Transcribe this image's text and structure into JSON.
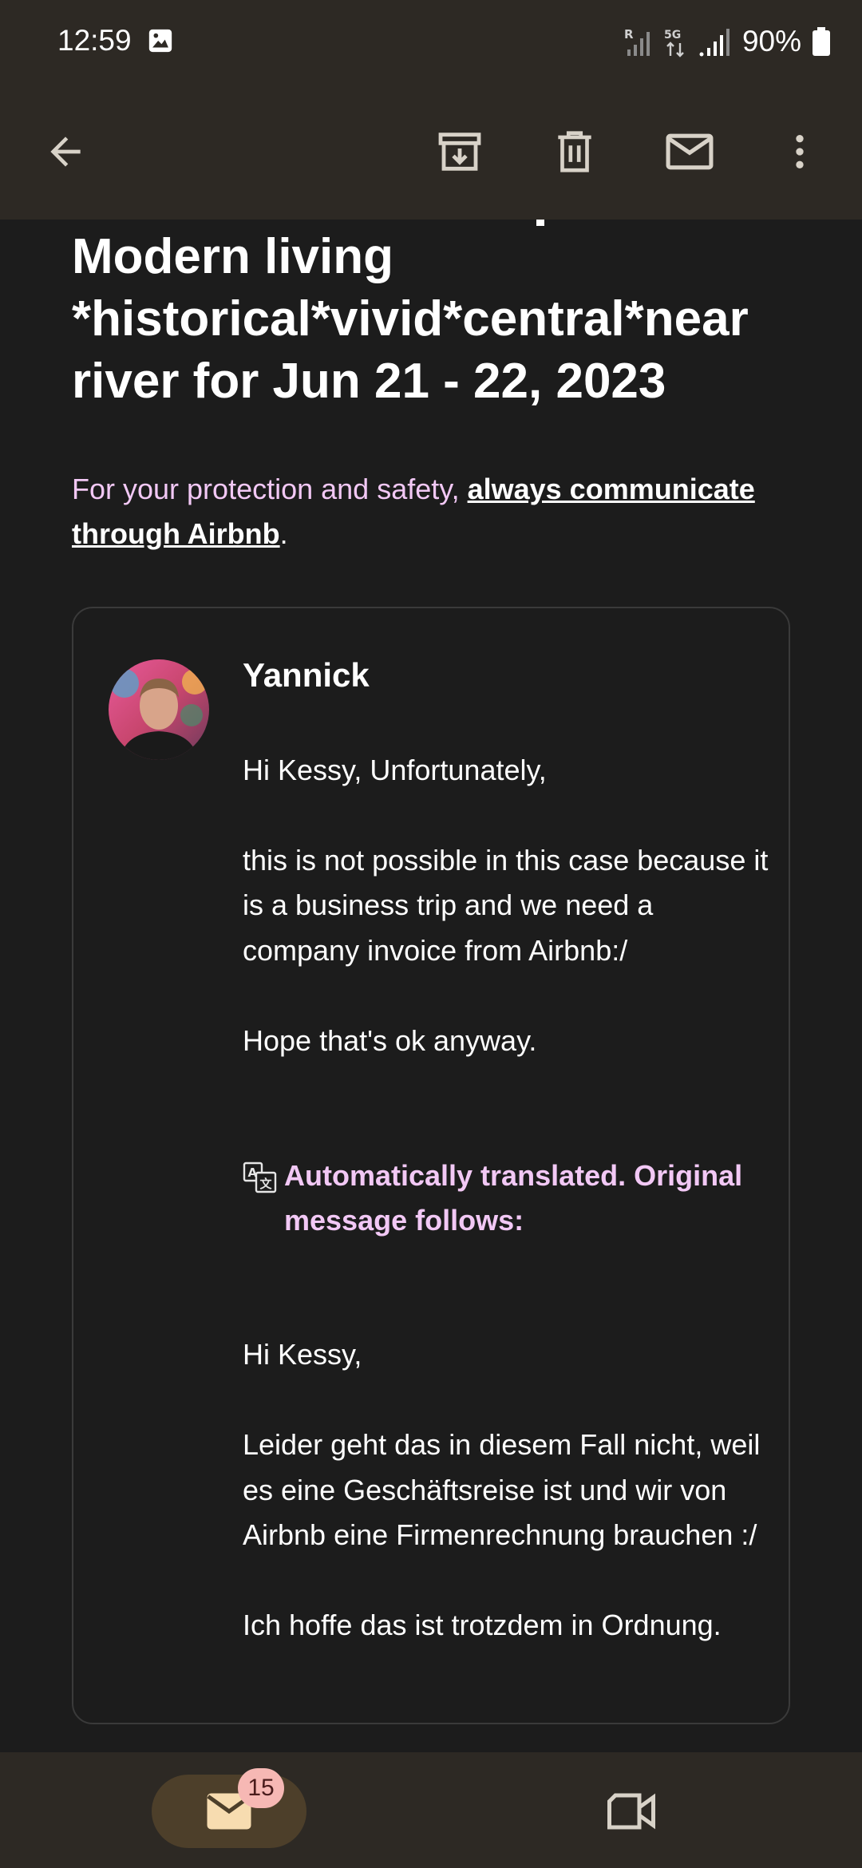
{
  "status_bar": {
    "time": "12:59",
    "battery_percent": "90%",
    "network_label": "5G"
  },
  "toolbar": {
    "icons": [
      "back-arrow-icon",
      "archive-icon",
      "delete-icon",
      "mark-unread-icon",
      "more-vert-icon"
    ]
  },
  "email": {
    "subject": "Modern living *historical*vivid*central*near river for Jun 21 - 22, 2023",
    "safety_prefix": "For your protection and safety, ",
    "safety_link": "always communicate through Airbnb",
    "safety_suffix": "."
  },
  "message": {
    "sender": "Yannick",
    "body_en": "Hi Kessy, Unfortunately,\n\nthis is not possible in this case because it is a business trip and we need a company invoice from Airbnb:/\n\nHope that's ok anyway.",
    "translated_notice": "Automatically translated. Original message follows:",
    "body_original": "Hi Kessy,\n\nLeider geht das in diesem Fall nicht, weil es eine Geschäftsreise ist und wir von Airbnb eine Firmenrechnung brauchen :/\n\nIch hoffe das ist trotzdem in Ordnung."
  },
  "bottom_nav": {
    "mail_badge": "15"
  },
  "colors": {
    "accent_pink": "#f2c8f5",
    "bar_bg": "#2d2924",
    "page_bg": "#1c1c1c",
    "badge_bg": "#f6b8b4"
  }
}
